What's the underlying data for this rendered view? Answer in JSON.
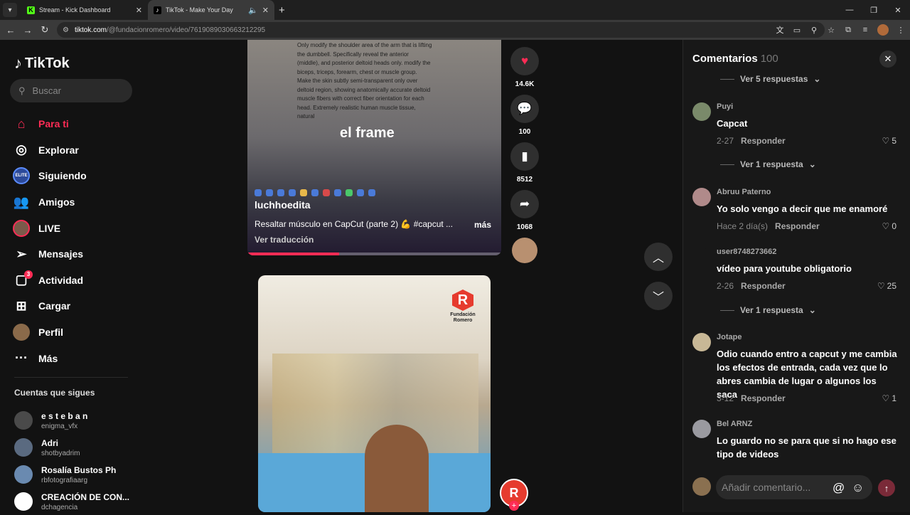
{
  "browser": {
    "tabs": [
      {
        "title": "Stream - Kick Dashboard"
      },
      {
        "title": "TikTok - Make Your Day"
      }
    ],
    "url_host": "tiktok.com",
    "url_path": "/@fundacionromero/video/7619089030663212295"
  },
  "sidebar": {
    "logo": "TikTok",
    "search_placeholder": "Buscar",
    "nav": [
      {
        "label": "Para ti"
      },
      {
        "label": "Explorar"
      },
      {
        "label": "Siguiendo"
      },
      {
        "label": "Amigos"
      },
      {
        "label": "LIVE"
      },
      {
        "label": "Mensajes"
      },
      {
        "label": "Actividad",
        "badge": "3"
      },
      {
        "label": "Cargar"
      },
      {
        "label": "Perfil"
      },
      {
        "label": "Más"
      }
    ],
    "following_title": "Cuentas que sigues",
    "following": [
      {
        "name": "e s t e b a n",
        "user": "enigma_vfx"
      },
      {
        "name": "Adri",
        "user": "shotbyadrim"
      },
      {
        "name": "Rosalía Bustos Ph",
        "user": "rbfotografiaarg"
      },
      {
        "name": "CREACIÓN DE CON...",
        "user": "dchagencia"
      }
    ]
  },
  "video1": {
    "overlay_text": "Only modify the shoulder area of the arm that is lifting the dumbbell. Specifically reveal the anterior (middle), and posterior deltoid heads only. modify the biceps, triceps, forearm, chest or muscle group. Make the skin subtly semi-transparent only over deltoid region, showing anatomically accurate deltoid muscle fibers with correct fiber orientation for each head. Extremely realistic human muscle tissue, natural",
    "caption": "el frame",
    "author": "luchhoedita",
    "description": "Resaltar músculo en CapCut (parte 2) 💪 #capcut ...",
    "more": "más",
    "translate": "Ver traducción",
    "progress_pct": 36
  },
  "actions": {
    "likes": "14.6K",
    "comments": "100",
    "saves": "8512",
    "shares": "1068"
  },
  "video2": {
    "logo_letter": "R",
    "logo_name_1": "Fundación",
    "logo_name_2": "Romero"
  },
  "comments_panel": {
    "title": "Comentarios",
    "count": "100",
    "top_replies": "Ver 5 respuestas",
    "items": [
      {
        "user": "Puyi",
        "text": "Capcat",
        "date": "2-27",
        "reply": "Responder",
        "likes": "5",
        "view_replies": "Ver 1 respuesta"
      },
      {
        "user": "Abruu Paterno",
        "text": "Yo solo vengo a decir que me enamoré",
        "date": "Hace 2 día(s)",
        "reply": "Responder",
        "likes": "0"
      },
      {
        "user": "user8748273662",
        "text": "vídeo para youtube obligatorio",
        "date": "2-26",
        "reply": "Responder",
        "likes": "25",
        "view_replies": "Ver 1 respuesta"
      },
      {
        "user": "Jotape",
        "text": "Odio cuando entro a capcut y me cambia los efectos de entrada, cada vez que lo abres cambia de lugar o algunos los saca",
        "date": "3-12",
        "reply": "Responder",
        "likes": "1"
      },
      {
        "user": "Bel ARNZ",
        "text": "Lo guardo no se para que si no hago ese tipo de videos"
      }
    ],
    "input_placeholder": "Añadir comentario..."
  }
}
